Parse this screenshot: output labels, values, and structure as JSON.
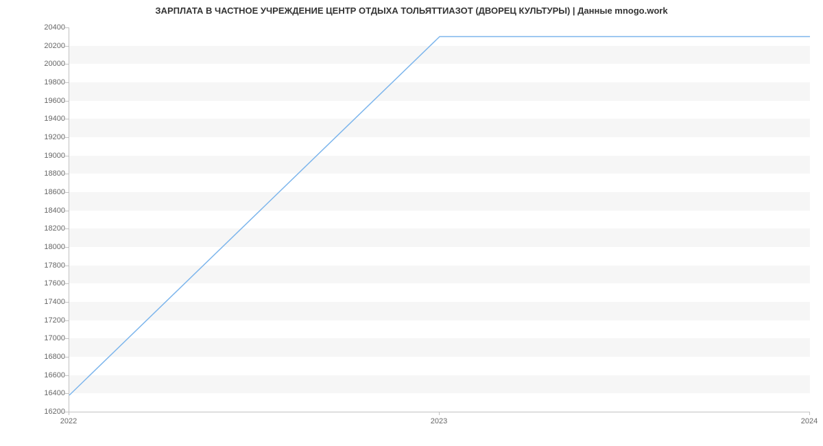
{
  "chart_data": {
    "type": "line",
    "title": "ЗАРПЛАТА В ЧАСТНОЕ УЧРЕЖДЕНИЕ ЦЕНТР ОТДЫХА ТОЛЬЯТТИАЗОТ (ДВОРЕЦ КУЛЬТУРЫ) | Данные mnogo.work",
    "x": [
      "2022",
      "2023",
      "2024"
    ],
    "values": [
      16380,
      20300,
      20300
    ],
    "xlabel": "",
    "ylabel": "",
    "ylim": [
      16200,
      20400
    ],
    "y_ticks": [
      16200,
      16400,
      16600,
      16800,
      17000,
      17200,
      17400,
      17600,
      17800,
      18000,
      18200,
      18400,
      18600,
      18800,
      19000,
      19200,
      19400,
      19600,
      19800,
      20000,
      20200,
      20400
    ],
    "x_ticks": [
      "2022",
      "2023",
      "2024"
    ],
    "line_color": "#7cb5ec"
  }
}
